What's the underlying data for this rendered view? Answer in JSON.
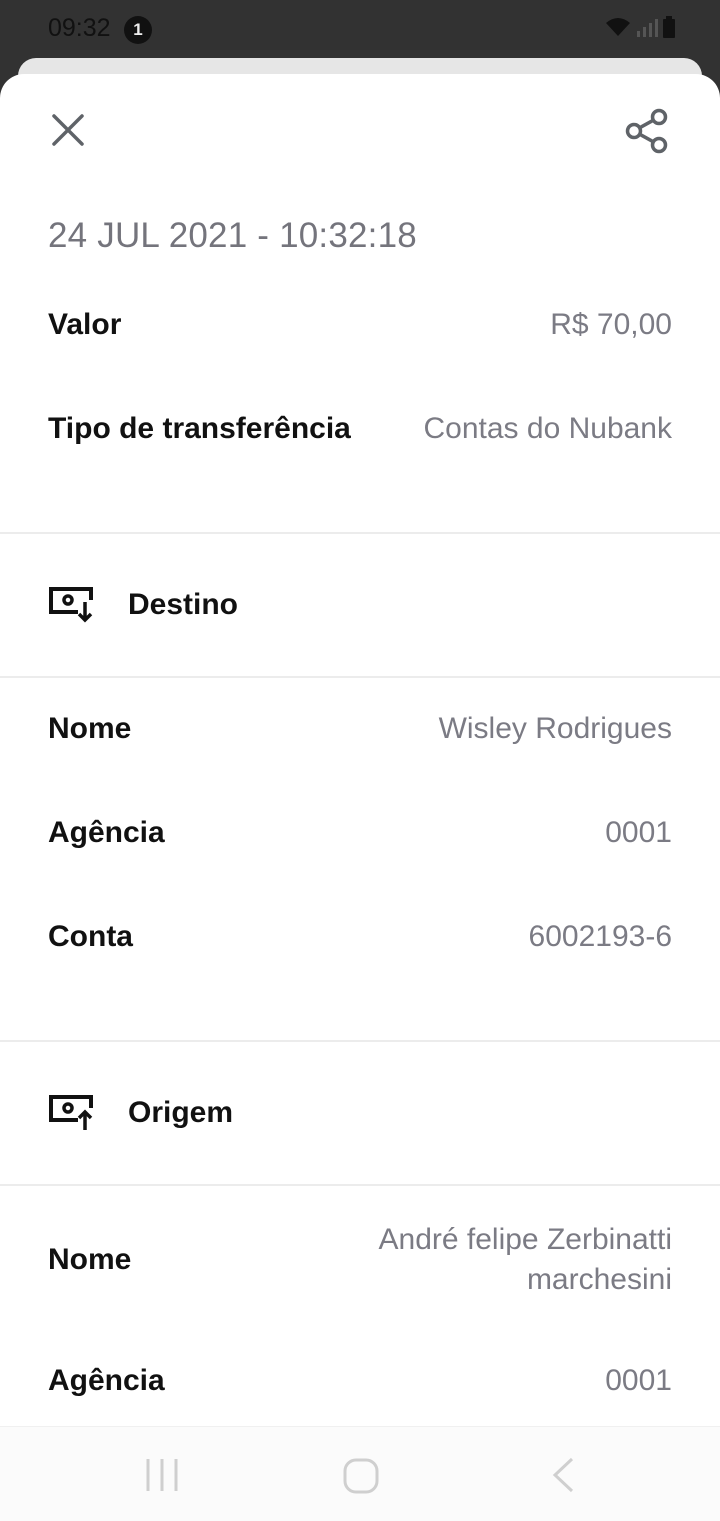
{
  "status_bar": {
    "time": "09:32",
    "notification_count": "1",
    "icons": [
      "wifi-icon",
      "signal-icon",
      "battery-icon"
    ]
  },
  "header": {
    "close_icon": "close-icon",
    "share_icon": "share-icon"
  },
  "transfer": {
    "datetime": "24 JUL 2021 - 10:32:18",
    "valor_label": "Valor",
    "valor_value": "R$ 70,00",
    "tipo_label": "Tipo de transferência",
    "tipo_value": "Contas do Nubank"
  },
  "destino": {
    "title": "Destino",
    "icon": "account-download-icon",
    "nome_label": "Nome",
    "nome_value": "Wisley Rodrigues",
    "agencia_label": "Agência",
    "agencia_value": "0001",
    "conta_label": "Conta",
    "conta_value": "6002193-6"
  },
  "origem": {
    "title": "Origem",
    "icon": "account-upload-icon",
    "nome_label": "Nome",
    "nome_value_line1": "André felipe Zerbinatti",
    "nome_value_line2": "marchesini",
    "agencia_label": "Agência",
    "agencia_value": "0001"
  },
  "nav_bar": {
    "items": [
      "recent-apps-icon",
      "home-icon",
      "back-icon"
    ]
  },
  "colors": {
    "status_bg": "#323232",
    "value_gray": "#7b7b84",
    "icon_gray": "#5f6368"
  }
}
